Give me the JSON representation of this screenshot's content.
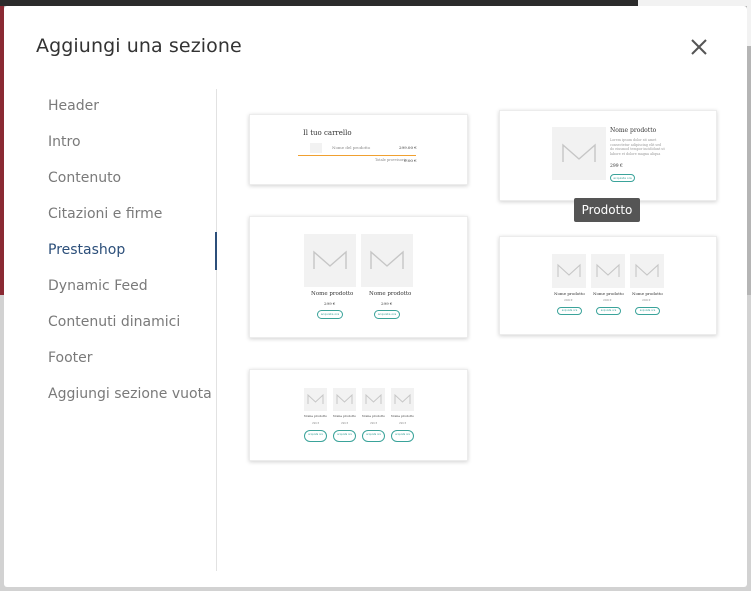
{
  "modal": {
    "title": "Aggiungi una sezione",
    "close_icon": "close-icon"
  },
  "sidebar": {
    "active_index": 4,
    "items": [
      {
        "label": "Header"
      },
      {
        "label": "Intro"
      },
      {
        "label": "Contenuto"
      },
      {
        "label": "Citazioni e firme"
      },
      {
        "label": "Prestashop"
      },
      {
        "label": "Dynamic Feed"
      },
      {
        "label": "Contenuti dinamici"
      },
      {
        "label": "Footer"
      },
      {
        "label": "Aggiungi sezione vuota"
      }
    ]
  },
  "tooltip": "Prodotto",
  "templates": {
    "cart": {
      "title": "Il tuo carrello",
      "item_name": "Nome del prodotto",
      "item_price": "299.00 €",
      "total_label": "Totale provvisorio:",
      "total_value": "0.00 €"
    },
    "product_detail": {
      "name": "Nome prodotto",
      "description": "Lorem ipsum dolor sit amet consectetur adipiscing elit sed do eiusmod tempor incididunt ut labore et dolore magna aliqua",
      "price": "299 €",
      "button": "acquista ora"
    },
    "two_products": {
      "name": "Nome prodotto",
      "price": "299 €",
      "button": "acquista ora"
    },
    "three_products": {
      "name": "Nome prodotto",
      "price": "299 €",
      "button": "acquista ora"
    },
    "four_products": {
      "name": "Nome prodotto",
      "price": "299 €",
      "button": "acquista ora"
    }
  },
  "colors": {
    "accent": "#2c4f7a",
    "button_outline": "#3aa39a",
    "cart_line": "#f0a030"
  }
}
